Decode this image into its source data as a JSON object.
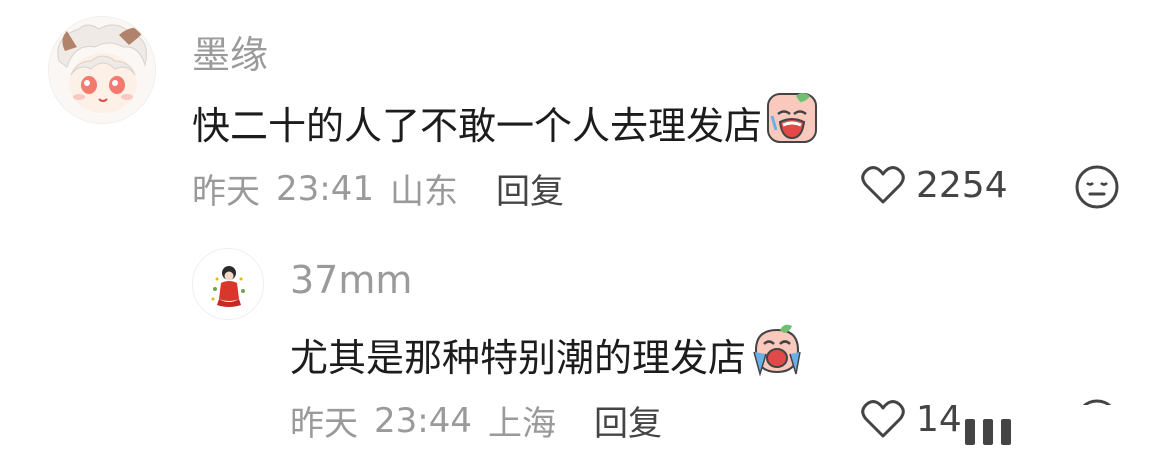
{
  "comments": [
    {
      "username": "墨缘",
      "text": "快二十的人了不敢一个人去理发店",
      "emoji": "crying-face-emoji",
      "date": "昨天",
      "time": "23:41",
      "location": "山东",
      "reply_label": "回复",
      "likes": "2254"
    },
    {
      "username": "37mm",
      "text": "尤其是那种特别潮的理发店",
      "emoji": "sobbing-face-emoji",
      "date": "昨天",
      "time": "23:44",
      "location": "上海",
      "reply_label": "回复",
      "likes": "14"
    }
  ],
  "colors": {
    "username": "#9a9a9a",
    "meta": "#9a9a9a",
    "text": "#1c1c1c",
    "emoji_face": "#f7b8a8",
    "emoji_mouth": "#e24a4a"
  }
}
